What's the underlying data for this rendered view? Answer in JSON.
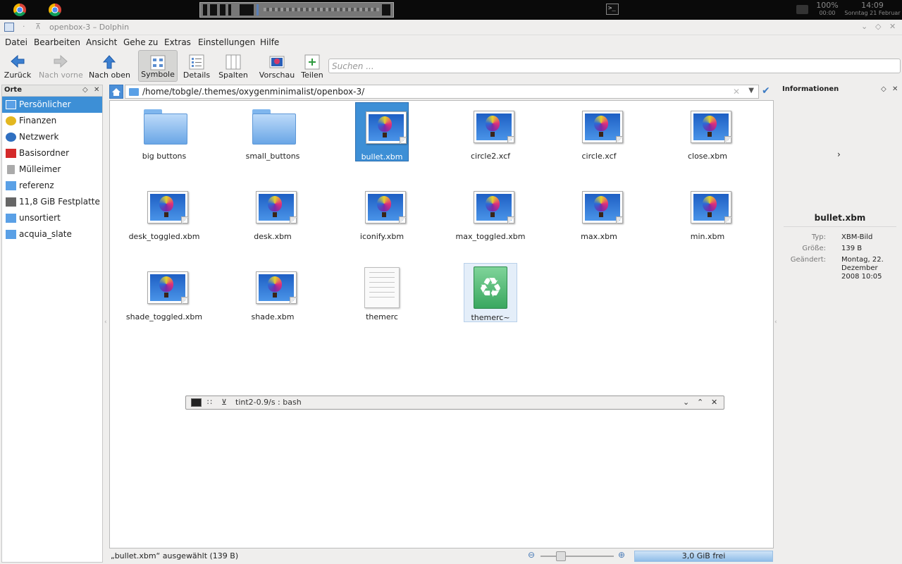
{
  "panel": {
    "battery_percent": "100%",
    "battery_time": "00:00",
    "clock_time": "14:09",
    "clock_date": "Sonntag 21 Februar",
    "terminal_glyph": ">_"
  },
  "window": {
    "title": "openbox-3 – Dolphin"
  },
  "menu": [
    "Datei",
    "Bearbeiten",
    "Ansicht",
    "Gehe zu",
    "Extras",
    "Einstellungen",
    "Hilfe"
  ],
  "toolbar": {
    "back": "Zurück",
    "forward": "Nach vorne",
    "up": "Nach oben",
    "icons": "Symbole",
    "details": "Details",
    "columns": "Spalten",
    "preview": "Vorschau",
    "split": "Teilen",
    "search_placeholder": "Suchen ..."
  },
  "places": {
    "title": "Orte",
    "items": [
      {
        "label": "Persönlicher Ordner",
        "icon": "home-folder-icon",
        "color": "#5aa0e6"
      },
      {
        "label": "Finanzen",
        "icon": "coins-icon",
        "color": "#e3b720"
      },
      {
        "label": "Netzwerk",
        "icon": "globe-icon",
        "color": "#2f6fc0"
      },
      {
        "label": "Basisordner",
        "icon": "root-folder-icon",
        "color": "#d42a2a"
      },
      {
        "label": "Mülleimer",
        "icon": "trash-icon",
        "color": "#aaaaaa"
      },
      {
        "label": "referenz",
        "icon": "folder-icon",
        "color": "#5aa0e6"
      },
      {
        "label": "11,8 GiB Festplatte",
        "icon": "harddisk-icon",
        "color": "#666666"
      },
      {
        "label": "unsortiert",
        "icon": "folder-icon",
        "color": "#5aa0e6"
      },
      {
        "label": "acquia_slate",
        "icon": "folder-icon",
        "color": "#5aa0e6"
      }
    ]
  },
  "path": "/home/tobgle/.themes/oxygenminimalist/openbox-3/",
  "files": [
    {
      "name": "big buttons",
      "type": "folder"
    },
    {
      "name": "small_buttons",
      "type": "folder"
    },
    {
      "name": "bullet.xbm",
      "type": "image",
      "state": "selected"
    },
    {
      "name": "circle2.xcf",
      "type": "image"
    },
    {
      "name": "circle.xcf",
      "type": "image"
    },
    {
      "name": "close.xbm",
      "type": "image"
    },
    {
      "name": "desk_toggled.xbm",
      "type": "image"
    },
    {
      "name": "desk.xbm",
      "type": "image"
    },
    {
      "name": "iconify.xbm",
      "type": "image"
    },
    {
      "name": "max_toggled.xbm",
      "type": "image"
    },
    {
      "name": "max.xbm",
      "type": "image"
    },
    {
      "name": "min.xbm",
      "type": "image"
    },
    {
      "name": "shade_toggled.xbm",
      "type": "image"
    },
    {
      "name": "shade.xbm",
      "type": "image"
    },
    {
      "name": "themerc",
      "type": "text"
    },
    {
      "name": "themerc~",
      "type": "backup",
      "state": "hover"
    }
  ],
  "terminal_dock": {
    "title": "tint2-0.9/s : bash"
  },
  "info": {
    "title": "Informationen",
    "filename": "bullet.xbm",
    "type_label": "Typ:",
    "type_value": "XBM-Bild",
    "size_label": "Größe:",
    "size_value": "139 B",
    "modified_label": "Geändert:",
    "modified_value": "Montag, 22. Dezember 2008 10:05"
  },
  "status": {
    "text": "„bullet.xbm“ ausgewählt (139 B)",
    "free_space": "3,0 GiB frei"
  }
}
